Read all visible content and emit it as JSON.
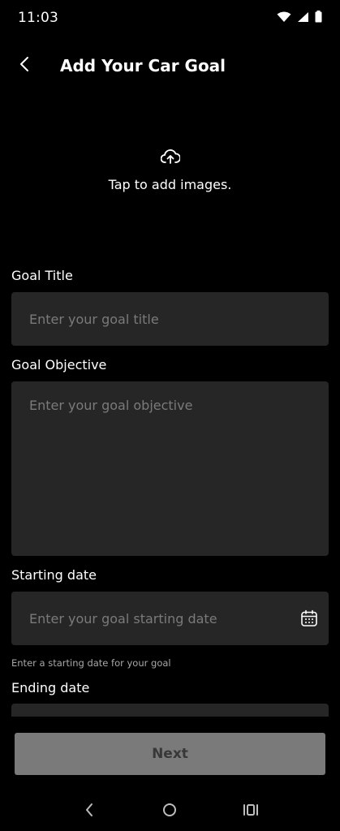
{
  "status": {
    "time": "11:03"
  },
  "header": {
    "title": "Add Your Car Goal"
  },
  "upload": {
    "text": "Tap to add images."
  },
  "form": {
    "goal_title": {
      "label": "Goal Title",
      "placeholder": "Enter your goal title",
      "value": ""
    },
    "goal_objective": {
      "label": "Goal Objective",
      "placeholder": "Enter your goal objective",
      "value": ""
    },
    "starting_date": {
      "label": "Starting date",
      "placeholder": "Enter your goal starting date",
      "helper": "Enter a starting date for your goal",
      "value": ""
    },
    "ending_date": {
      "label": "Ending date"
    }
  },
  "footer": {
    "next_label": "Next"
  },
  "colors": {
    "background": "#000000",
    "field": "#262626",
    "button_disabled": "#7a7a7a"
  }
}
